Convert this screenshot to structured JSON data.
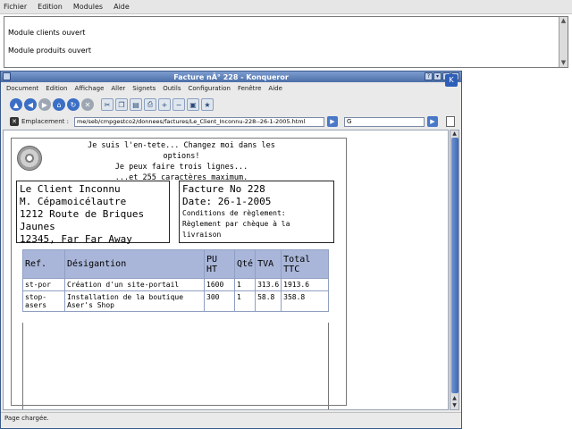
{
  "bg_app": {
    "menu": [
      "Fichier",
      "Edition",
      "Modules",
      "Aide"
    ],
    "log_lines": [
      "Module clients ouvert",
      "Module produits ouvert"
    ]
  },
  "konqueror": {
    "title": "Facture nÂ° 228 - Konqueror",
    "menu": [
      "Document",
      "Edition",
      "Affichage",
      "Aller",
      "Signets",
      "Outils",
      "Configuration",
      "Fenêtre",
      "Aide"
    ],
    "location_label": "Emplacement :",
    "location_value": "me/seb/cmpgestco2/donnees/factures/Le_Client_Inconnu-228--26-1-2005.html",
    "search_value": "G",
    "status": "Page chargée."
  },
  "invoice": {
    "header_lines": [
      "Je suis l'en-tete... Changez moi dans les options!",
      "Je peux faire trois lignes...",
      "...et 255 caractères maximum."
    ],
    "client_lines": [
      "Le Client Inconnu",
      "M. Cépamoicélautre",
      "1212 Route de Briques Jaunes",
      "12345, Far Far Away"
    ],
    "facture_no": "Facture No 228",
    "date": "Date: 26-1-2005",
    "conditions_label": "Conditions de règlement:",
    "conditions_value": "Règlement par chèque à la livraison",
    "table": {
      "headers": [
        "Ref.",
        "Désigantion",
        "PU HT",
        "Qté",
        "TVA",
        "Total TTC"
      ],
      "rows": [
        [
          "st-por",
          "Création d'un site-portail",
          "1600",
          "1",
          "313.6",
          "1913.6"
        ],
        [
          "stop-asers",
          "Installation de la boutique Aser's Shop",
          "300",
          "1",
          "58.8",
          "358.8"
        ]
      ]
    }
  }
}
